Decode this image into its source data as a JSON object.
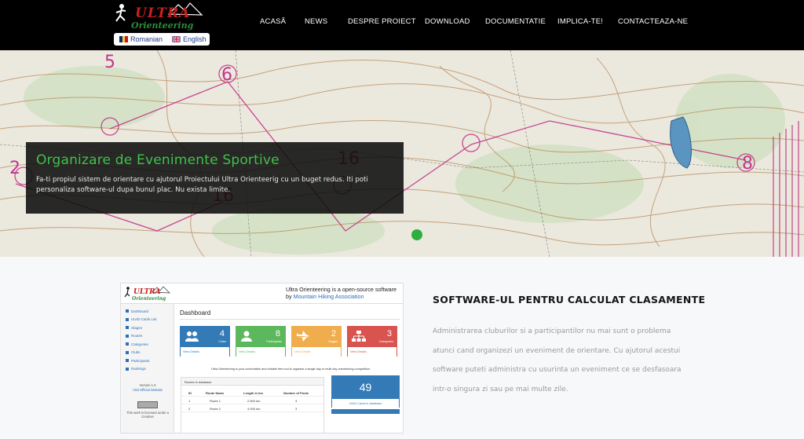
{
  "header": {
    "logo_text_top": "ULTRA",
    "logo_text_bottom": "Orienteering",
    "languages": [
      {
        "label": "Romanian",
        "flag": "romania-flag-icon"
      },
      {
        "label": "English",
        "flag": "uk-flag-icon"
      }
    ],
    "nav": [
      {
        "label": "ACASĂ"
      },
      {
        "label": "NEWS"
      },
      {
        "label": "DESPRE PROIECT"
      },
      {
        "label": "DOWNLOAD"
      },
      {
        "label": "DOCUMENTATIE"
      },
      {
        "label": "IMPLICA-TE!"
      },
      {
        "label": "CONTACTEAZA-NE"
      }
    ]
  },
  "hero": {
    "title": "Organizare de Evenimente Sportive",
    "text": "Fa-ti propiul sistem de orientare cu ajutorul Proiectului Ultra Orienteerig cu un buget redus. Iti poti personaliza software-ul dupa bunul plac. Nu exista limite.",
    "map_numbers": [
      "5",
      "6",
      "2",
      "16",
      "16",
      "8"
    ]
  },
  "preview": {
    "logo_top": "ULTRA",
    "logo_bottom": "Orienteering",
    "tagline": "Ultra Orienteering is a open-source software",
    "tagline_by": "by",
    "tagline_link": "Mountain Hiking Association",
    "sidebar": [
      "Dashboard",
      "UUID Cards List",
      "Stages",
      "Routes",
      "Categories",
      "Clubs",
      "Participants",
      "Rankings"
    ],
    "version": "Version 1.0",
    "official": "Visit Official Website",
    "license": "This work is licensed under a Creative",
    "dashboard_title": "Dashboard",
    "cards": [
      {
        "num": "4",
        "label": "Clubs",
        "foot": "View Details",
        "color": "#337ab7",
        "icon": "users-icon"
      },
      {
        "num": "8",
        "label": "Participants",
        "foot": "View Details",
        "color": "#5cb85c",
        "icon": "user-icon"
      },
      {
        "num": "2",
        "label": "Stages",
        "foot": "View Details",
        "color": "#f0ad4e",
        "icon": "plane-icon"
      },
      {
        "num": "3",
        "label": "Categories",
        "foot": "View Details",
        "color": "#d9534f",
        "icon": "sitemap-icon"
      }
    ],
    "description": "Ultra Orienteering is your comfortable and reliable free tool to organise a single day or multi day orienteering competition",
    "table_title": "Routes in database",
    "table_headers": [
      "ID",
      "Route Name",
      "Length in km",
      "Number of Posts"
    ],
    "table_rows": [
      [
        "1",
        "Route 1",
        "2.500 km",
        "3"
      ],
      [
        "2",
        "Route 2",
        "4.000 km",
        "3"
      ]
    ],
    "big_card_num": "49",
    "big_card_foot": "UUID Cards in database"
  },
  "section": {
    "title": "SOFTWARE-UL PENTRU CALCULAT CLASAMENTE",
    "text": "Administrarea cluburilor si a participantilor nu mai sunt o problema atunci cand organizezi un eveniment de orientare. Cu ajutorul acestui software puteti administra cu usurinta un eveniment ce se desfasoara intr-o singura zi sau pe mai multe zile."
  },
  "colors": {
    "accent": "#3fc24a",
    "logo_red": "#c8201e",
    "logo_green": "#2e8b3a"
  }
}
